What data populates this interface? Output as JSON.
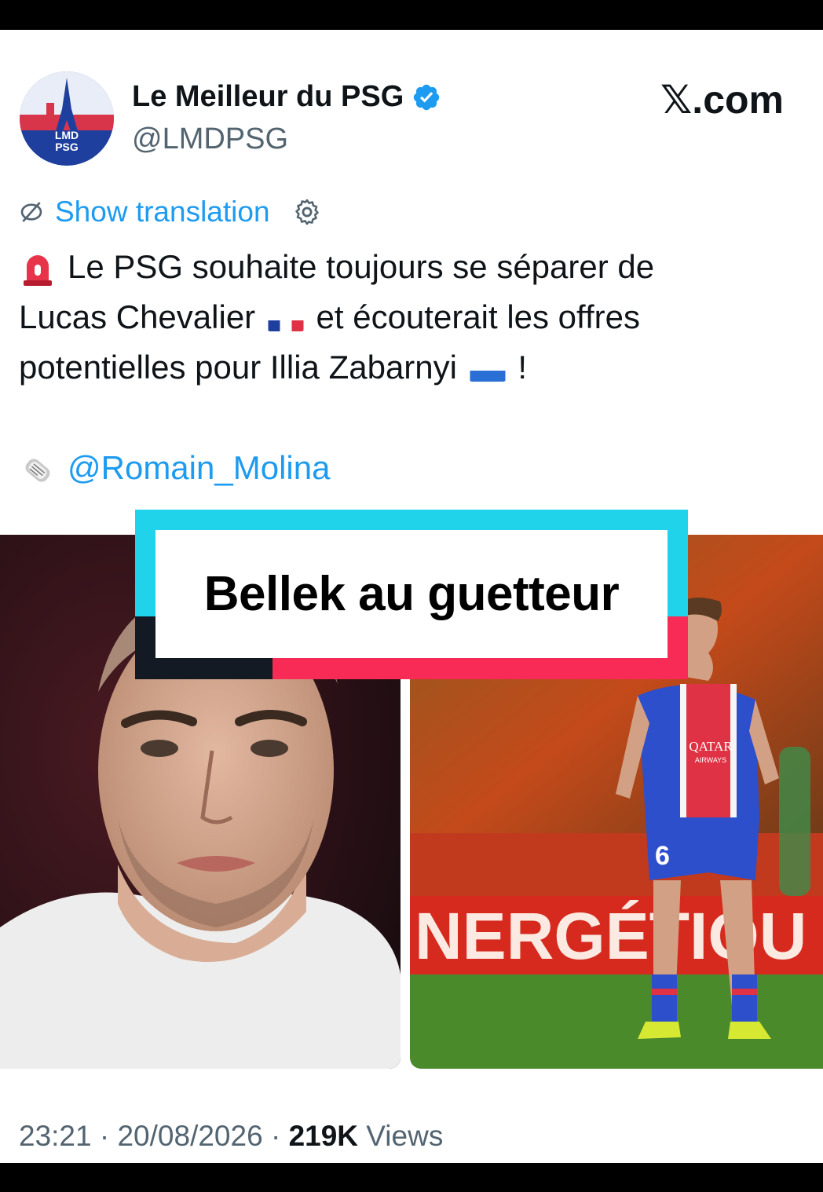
{
  "author": {
    "name": "Le Meilleur du PSG",
    "handle": "@LMDPSG",
    "avatar_text_line1": "LMD",
    "avatar_text_line2": "PSG"
  },
  "brand": "𝕏.com",
  "translation": {
    "label": "Show translation"
  },
  "tweet": {
    "line1": "Le PSG souhaite toujours se séparer de",
    "line2a": "Lucas Chevalier",
    "line2b": "et écouterait les offres",
    "line3a": "potentielles pour Illia Zabarnyi",
    "line3b": "!",
    "mention": "@Romain_Molina"
  },
  "overlay": {
    "caption": "Bellek au guetteur"
  },
  "media": {
    "right_photo_banner": "NERGÉTIQU",
    "jersey_sponsor": "QATAR",
    "jersey_sponsor_sub": "AIRWAYS",
    "jersey_number": "6"
  },
  "meta": {
    "time": "23:21",
    "date": "20/08/2026",
    "views_count": "219K",
    "views_label": "Views",
    "separator": "·"
  },
  "colors": {
    "link": "#1d9bf0",
    "overlay_cyan": "#21d3ea",
    "overlay_red": "#f72b55",
    "overlay_dark": "#141a24",
    "psg_blue": "#1f3f9e",
    "psg_red": "#e03245"
  }
}
